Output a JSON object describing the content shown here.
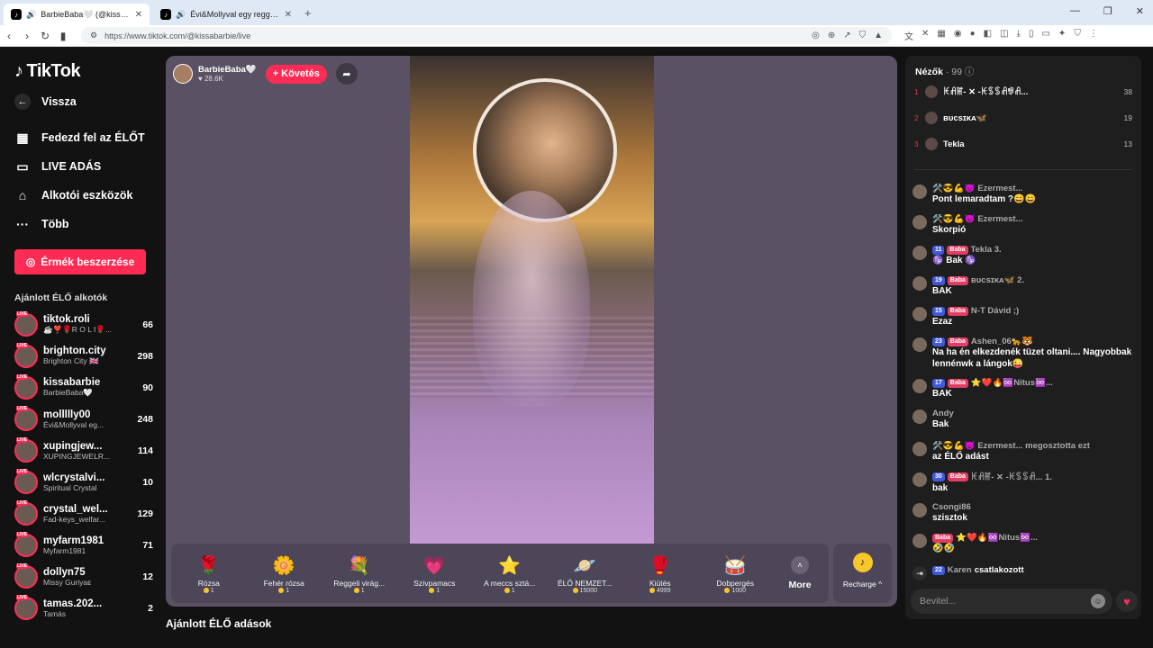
{
  "browser": {
    "tabs": [
      {
        "title": "BarbieBaba🤍 (@kissabarbie",
        "active": true
      },
      {
        "title": "Évi&Mollyval egy reggeli 🍮🤩",
        "active": false
      }
    ],
    "url": "https://www.tiktok.com/@kissabarbie/live"
  },
  "sidebar": {
    "logo": "TikTok",
    "back": "Vissza",
    "nav": [
      "Fedezd fel az ÉLŐT",
      "LIVE ADÁS",
      "Alkotói eszközök",
      "Több"
    ],
    "coins_button": "Érmék beszerzése",
    "section_title": "Ajánlott ÉLŐ alkotók",
    "live_tag": "LIVE",
    "creators": [
      {
        "name": "tiktok.roli",
        "sub": "☕❣️🌹R O L I🌹...",
        "count": "66"
      },
      {
        "name": "brighton.city",
        "sub": "Brighton City 🇬🇧",
        "count": "298"
      },
      {
        "name": "kissabarbie",
        "sub": "BarbieBaba🤍",
        "count": "90"
      },
      {
        "name": "mollllly00",
        "sub": "Évi&Mollyval eg...",
        "count": "248"
      },
      {
        "name": "xupingjew...",
        "sub": "XUPINGJEWELR...",
        "count": "114"
      },
      {
        "name": "wlcrystalvi...",
        "sub": "Spiritual Crystal",
        "count": "10"
      },
      {
        "name": "crystal_wel...",
        "sub": "Fad-keys_welfar...",
        "count": "129"
      },
      {
        "name": "myfarm1981",
        "sub": "Myfarm1981",
        "count": "71"
      },
      {
        "name": "dollyn75",
        "sub": "Missy Guriyaᴇ",
        "count": "12"
      },
      {
        "name": "tamas.202...",
        "sub": "Tamás",
        "count": "2"
      }
    ]
  },
  "stream": {
    "streamer_name": "BarbieBaba🤍",
    "likes": "♥ 28.6K",
    "follow_button": "+ Követés",
    "below_title": "Ajánlott ÉLŐ adások"
  },
  "gifts": [
    {
      "name": "Rózsa",
      "price": "1",
      "icon": "🌹"
    },
    {
      "name": "Fehér rózsa",
      "price": "1",
      "icon": "🌼"
    },
    {
      "name": "Reggeli virág...",
      "price": "1",
      "icon": "💐"
    },
    {
      "name": "Szívpamacs",
      "price": "1",
      "icon": "💗"
    },
    {
      "name": "A meccs sztá...",
      "price": "1",
      "icon": "⭐"
    },
    {
      "name": "ÉLŐ NEMZET...",
      "price": "15000",
      "icon": "🪐"
    },
    {
      "name": "Kiütés",
      "price": "4999",
      "icon": "🥊"
    },
    {
      "name": "Dobpergés",
      "price": "1000",
      "icon": "🥁"
    }
  ],
  "gift_more": "More",
  "recharge": "Recharge ^",
  "chat": {
    "viewers_label": "Nézők",
    "viewers_count": "· 99",
    "top_viewers": [
      {
        "rank": "1",
        "name": "ꀘꋬꂵ- ✕ -ꀘꌗꌗꋬꃃꋬ...",
        "score": "38"
      },
      {
        "rank": "2",
        "name": "ʙᴜᴄsɪᴋᴀ🦋",
        "score": "19"
      },
      {
        "rank": "3",
        "name": "Tekla",
        "score": "13"
      }
    ],
    "messages": [
      {
        "badges": [
          "🛠️😎💪😈"
        ],
        "user": "Ezermest...",
        "text": "Pont lemaradtam ?😄😄"
      },
      {
        "badges": [
          "🛠️😎💪😈"
        ],
        "user": "Ezermest...",
        "text": "Skorpió"
      },
      {
        "badges": [
          "11",
          "Baba"
        ],
        "user": "Tekla  3.",
        "text": "♑ Bak ♑"
      },
      {
        "badges": [
          "19",
          "Baba"
        ],
        "user": "ʙᴜᴄsɪᴋᴀ🦋  2.",
        "text": "BAK"
      },
      {
        "badges": [
          "15",
          "Baba"
        ],
        "user": "N-T Dávid ;)",
        "text": "Ezaz"
      },
      {
        "badges": [
          "23",
          "Baba"
        ],
        "user": "Ashen_06🐆🐯",
        "text": "Na ha én elkezdenék tüzet oltani.... Nagyobbak lennénwk a lángok😜"
      },
      {
        "badges": [
          "17",
          "Baba"
        ],
        "user": "⭐❤️🔥♾️Nitus♾️...",
        "text": "BAK"
      },
      {
        "badges": [],
        "user": "Andy",
        "text": "Bak"
      },
      {
        "badges": [
          "🛠️😎💪😈"
        ],
        "user": "Ezermest...  megosztotta ezt",
        "text": "az ÉLŐ adást"
      },
      {
        "badges": [
          "30",
          "Baba"
        ],
        "user": "ꀘꋬꂵ- ✕ -ꀘꌗꌗꋬ...  1.",
        "text": "bak"
      },
      {
        "badges": [],
        "user": "Csongi86",
        "text": "szisztok"
      },
      {
        "badges": [
          "Baba"
        ],
        "user": "⭐❤️🔥♾️Nitus♾️...",
        "text": "🤣🤣"
      }
    ],
    "join": {
      "badge": "22",
      "user": "Karen",
      "text": "csatlakozott"
    },
    "input_placeholder": "Bevitel..."
  }
}
